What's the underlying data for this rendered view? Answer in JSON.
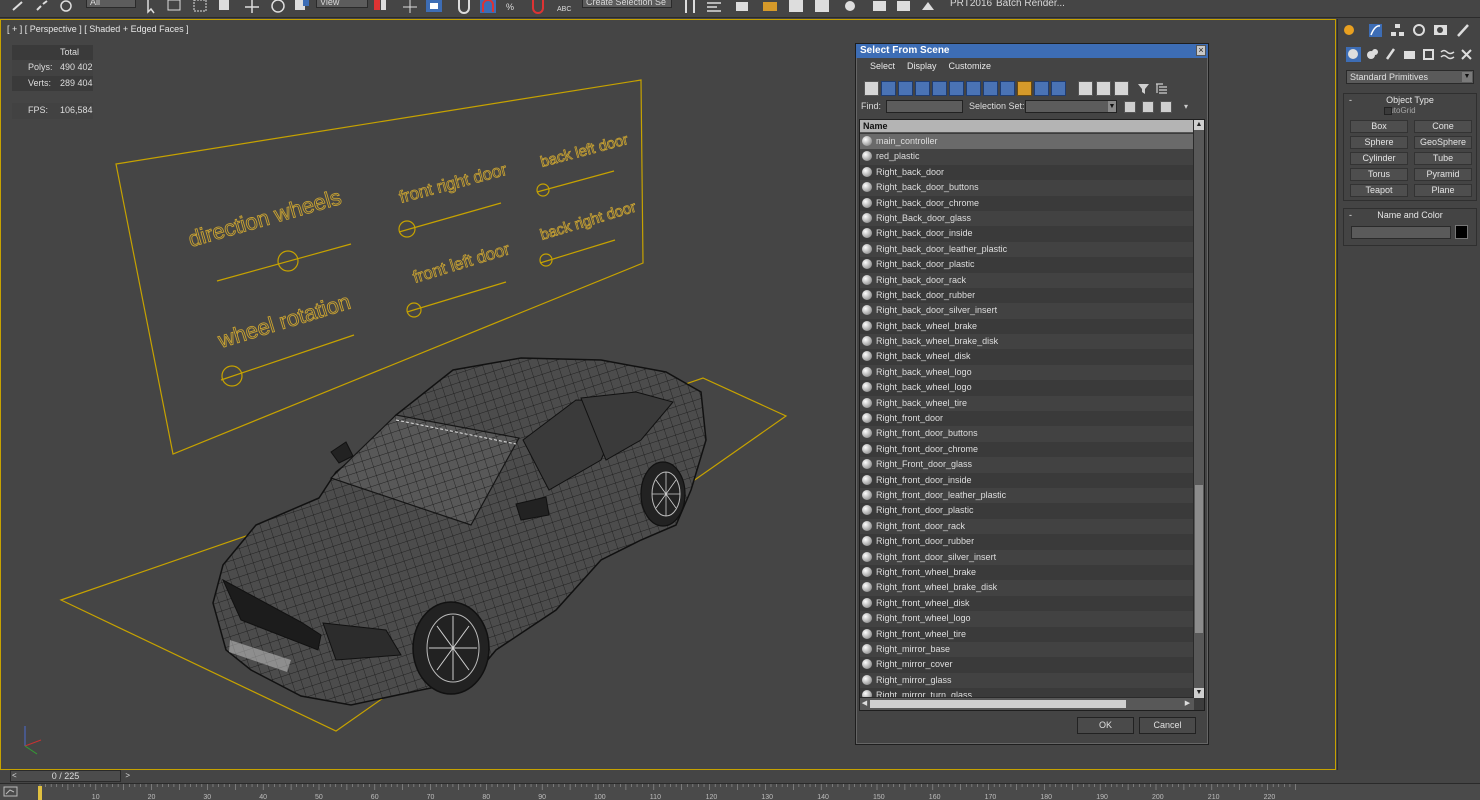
{
  "toolbar": {
    "dropdown_all": "All",
    "dropdown_view": "View",
    "dropdown_selection_set": "Create Selection Se",
    "label_prt": "PRT2016",
    "label_batch_render": "Batch Render..."
  },
  "viewport": {
    "label": "[ + ] [ Perspective ] [ Shaded + Edged Faces ]",
    "stats": {
      "header": "Total",
      "polys_label": "Polys:",
      "polys_value": "490 402",
      "verts_label": "Verts:",
      "verts_value": "289 404",
      "fps_label": "FPS:",
      "fps_value": "106,584"
    },
    "rig_labels": {
      "direction_wheels": "direction wheels",
      "front_right_door": "front right door",
      "back_left_door": "back left door",
      "wheel_rotation": "wheel rotation",
      "front_left_door": "front left door",
      "back_right_door": "back right door"
    }
  },
  "command_panel": {
    "category_dropdown": "Standard Primitives",
    "object_type": {
      "title": "Object Type",
      "autogrid": "AutoGrid",
      "buttons": [
        "Box",
        "Cone",
        "Sphere",
        "GeoSphere",
        "Cylinder",
        "Tube",
        "Torus",
        "Pyramid",
        "Teapot",
        "Plane"
      ]
    },
    "name_and_color": {
      "title": "Name and Color",
      "color": "#000000"
    }
  },
  "dialog": {
    "title": "Select From Scene",
    "menu": [
      "Select",
      "Display",
      "Customize"
    ],
    "find_label": "Find:",
    "selection_set_label": "Selection Set:",
    "column_header": "Name",
    "items": [
      "main_controller",
      "red_plastic",
      "Right_back_door",
      "Right_back_door_buttons",
      "Right_back_door_chrome",
      "Right_Back_door_glass",
      "Right_back_door_inside",
      "Right_back_door_leather_plastic",
      "Right_back_door_plastic",
      "Right_back_door_rack",
      "Right_back_door_rubber",
      "Right_back_door_silver_insert",
      "Right_back_wheel_brake",
      "Right_back_wheel_brake_disk",
      "Right_back_wheel_disk",
      "Right_back_wheel_logo",
      "Right_back_wheel_logo",
      "Right_back_wheel_tire",
      "Right_front_door",
      "Right_front_door_buttons",
      "Right_front_door_chrome",
      "Right_Front_door_glass",
      "Right_front_door_inside",
      "Right_front_door_leather_plastic",
      "Right_front_door_plastic",
      "Right_front_door_rack",
      "Right_front_door_rubber",
      "Right_front_door_silver_insert",
      "Right_front_wheel_brake",
      "Right_front_wheel_brake_disk",
      "Right_front_wheel_disk",
      "Right_front_wheel_logo",
      "Right_front_wheel_tire",
      "Right_mirror_base",
      "Right_mirror_cover",
      "Right_mirror_glass",
      "Right_mirror_turn_glass"
    ],
    "ok_label": "OK",
    "cancel_label": "Cancel"
  },
  "timeline": {
    "frame_label": "0 / 225",
    "ticks": [
      "10",
      "20",
      "30",
      "40",
      "50",
      "60",
      "70",
      "80",
      "90",
      "100",
      "110",
      "120",
      "130",
      "140",
      "150",
      "160",
      "170",
      "180",
      "190",
      "200",
      "210",
      "220"
    ]
  },
  "colors": {
    "accent_yellow": "#c6a200",
    "stats_yellow": "#f0dc3c",
    "rig_text": "#c8a232",
    "title_blue": "#3d6db5"
  }
}
